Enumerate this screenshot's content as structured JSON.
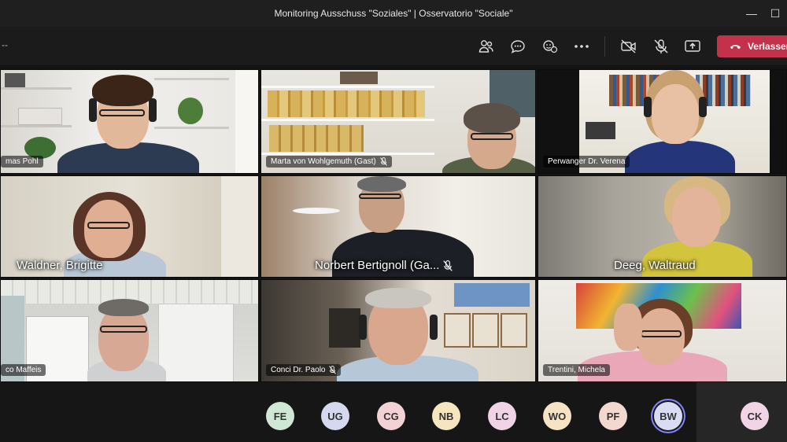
{
  "window": {
    "title": "Monitoring Ausschuss \"Soziales\" | Osservatorio \"Sociale\"",
    "minimize_glyph": "—",
    "maximize_glyph": "☐"
  },
  "toolbar": {
    "left_text": "--",
    "leave_label": "Verlassen",
    "icons": [
      "people-icon",
      "chat-icon",
      "reactions-icon",
      "more-icon",
      "camera-off-icon",
      "mic-off-icon",
      "share-icon",
      "phone-hangup-icon"
    ]
  },
  "participants": [
    {
      "name": "mas Pohl",
      "muted": false,
      "style": "small"
    },
    {
      "name": "Marta von Wohlgemuth (Gast)",
      "muted": true,
      "style": "small"
    },
    {
      "name": "Perwanger Dr. Verena",
      "muted": false,
      "style": "small"
    },
    {
      "name": "Waldner, Brigitte",
      "muted": false,
      "style": "big"
    },
    {
      "name": "Norbert Bertignoll (Ga...",
      "muted": true,
      "style": "big"
    },
    {
      "name": "Deeg, Waltraud",
      "muted": false,
      "style": "big"
    },
    {
      "name": "co Maffeis",
      "muted": false,
      "style": "small"
    },
    {
      "name": "Conci Dr. Paolo",
      "muted": true,
      "style": "small"
    },
    {
      "name": "Trentini, Michela",
      "muted": false,
      "style": "small"
    }
  ],
  "roster": [
    {
      "initials": "FE",
      "color": "#cfe8d6"
    },
    {
      "initials": "UG",
      "color": "#d6d8f0"
    },
    {
      "initials": "CG",
      "color": "#f3d2d6"
    },
    {
      "initials": "NB",
      "color": "#f6e6bf"
    },
    {
      "initials": "LC",
      "color": "#f0d3e6"
    },
    {
      "initials": "WO",
      "color": "#f6e3c4"
    },
    {
      "initials": "PF",
      "color": "#f3d8cf"
    },
    {
      "initials": "BW",
      "color": "#d9dcf3",
      "active": true
    },
    {
      "initials": "CK",
      "color": "#f1d4e6"
    }
  ],
  "colors": {
    "leave_button": "#c4314b",
    "active_ring": "#7f85f5"
  }
}
